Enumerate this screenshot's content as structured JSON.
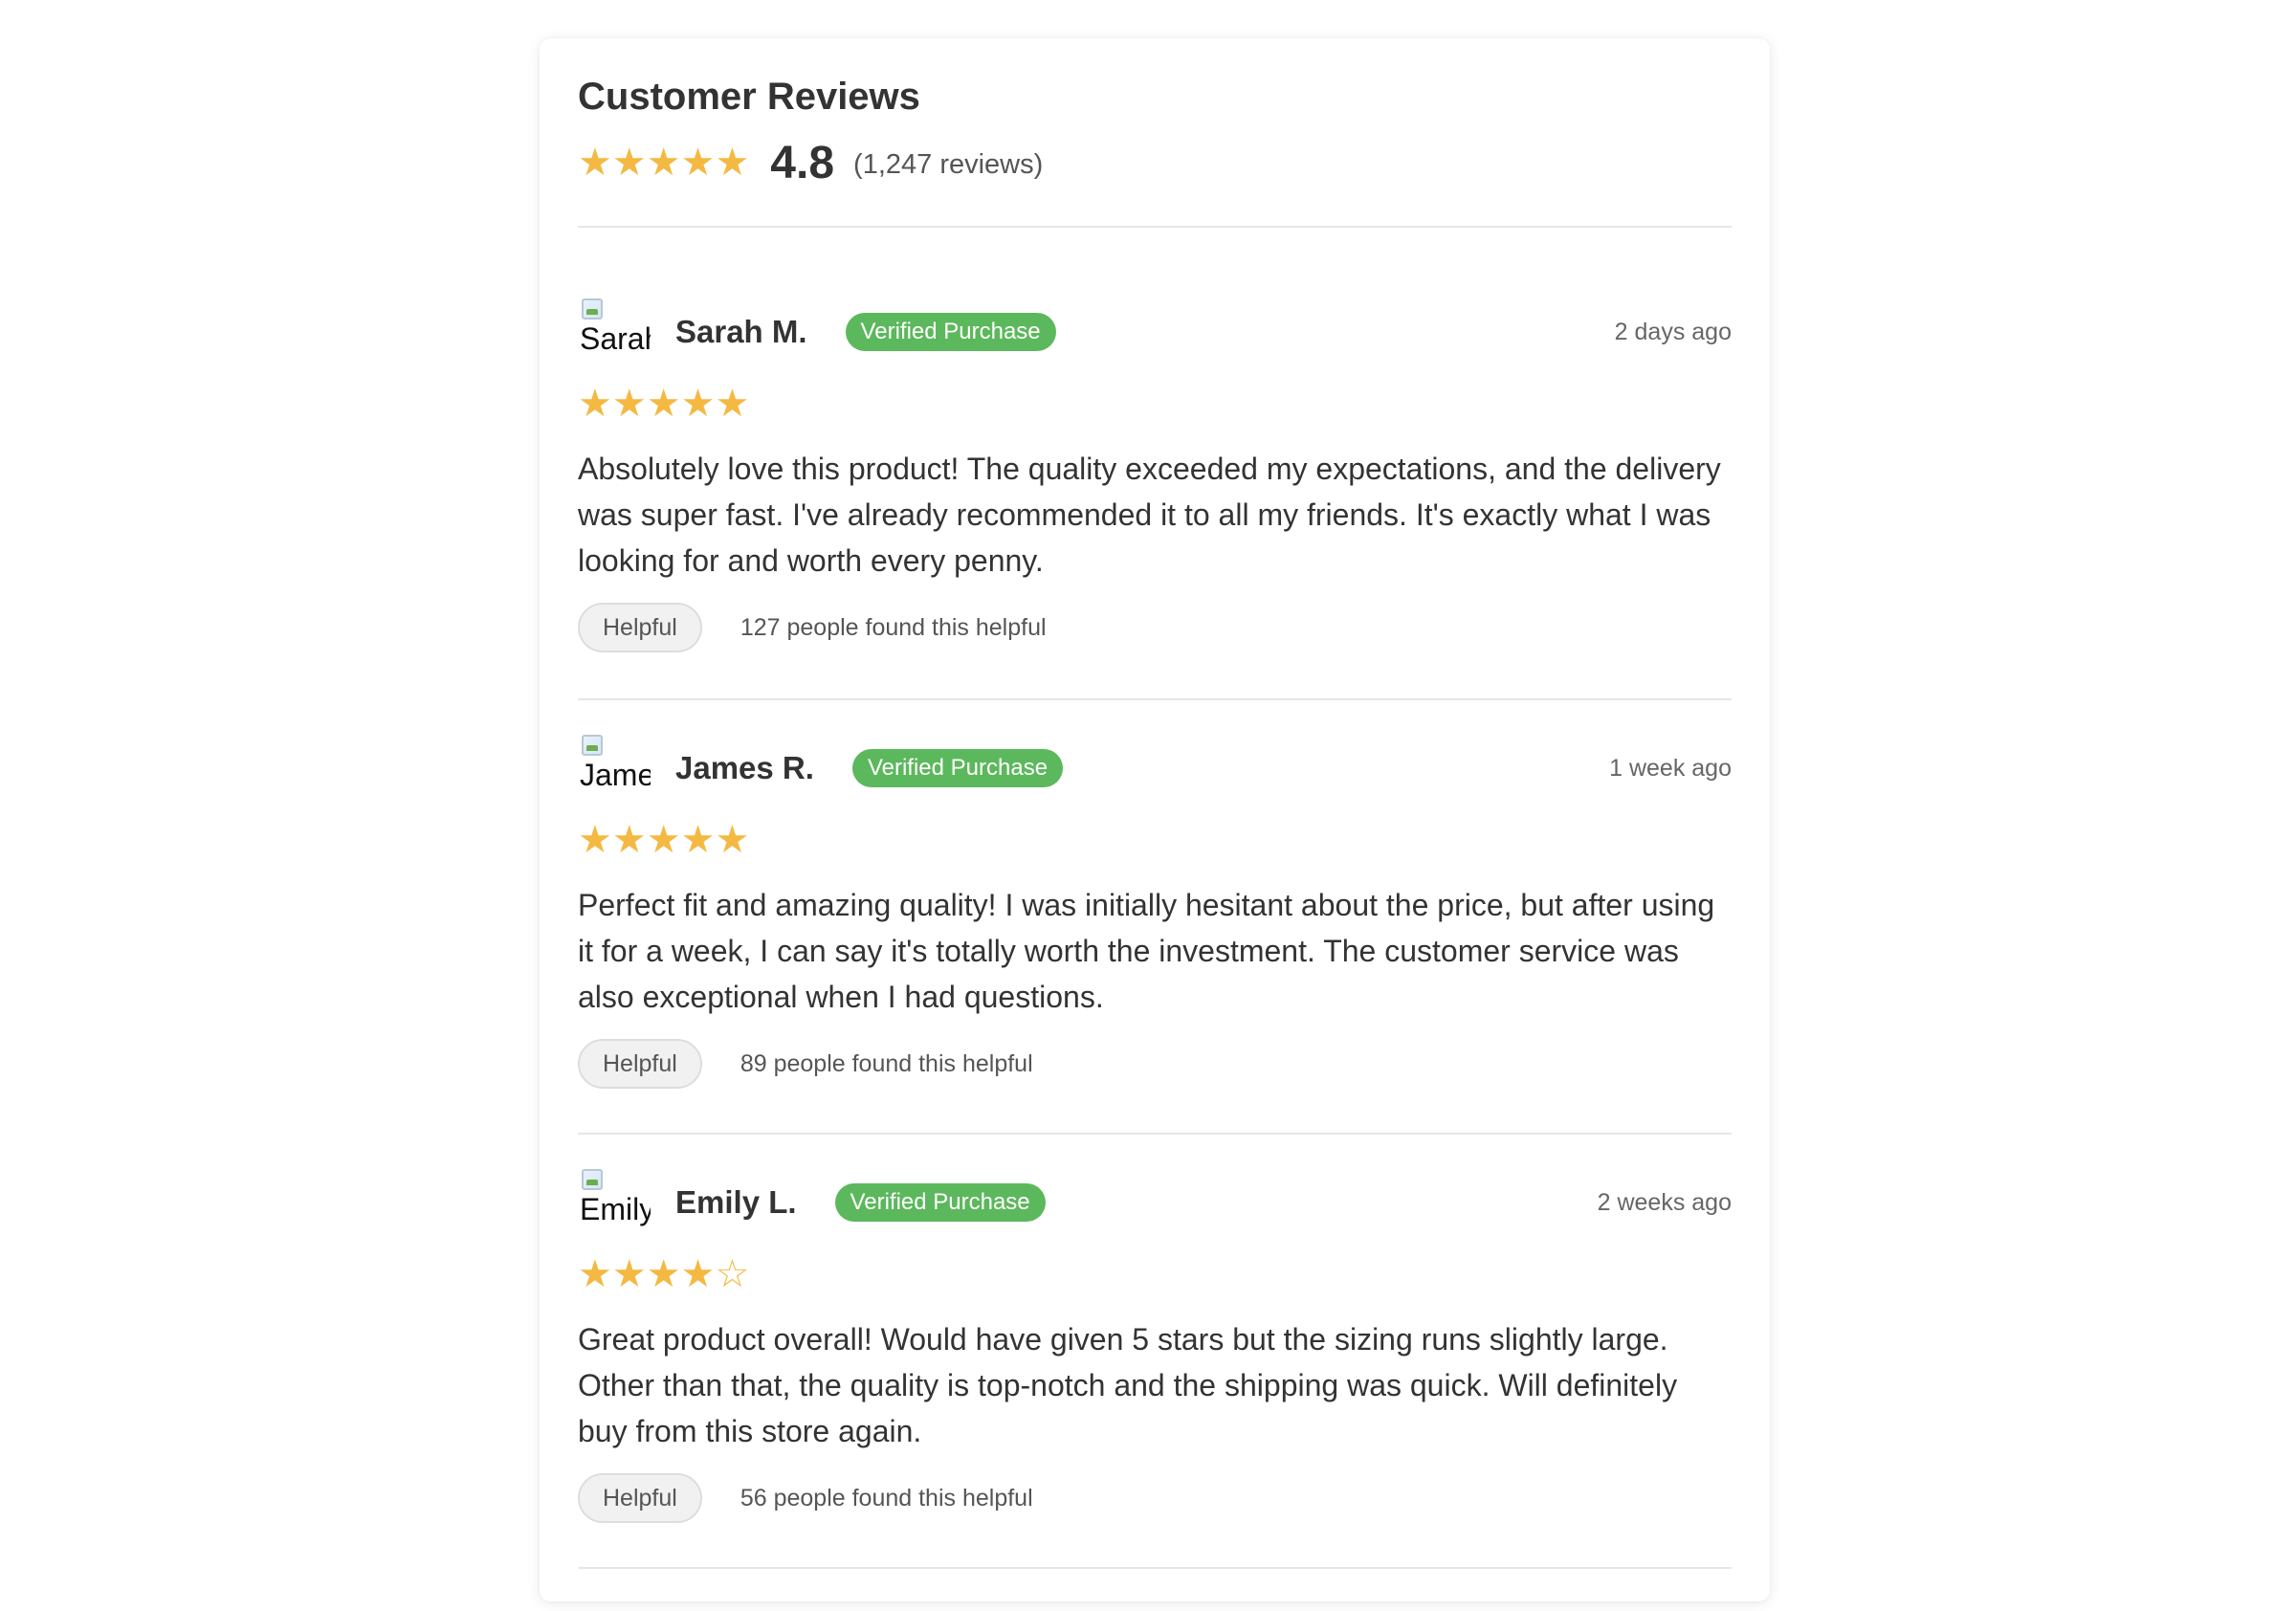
{
  "header": {
    "title": "Customer Reviews",
    "stars": "★★★★★",
    "average": "4.8",
    "count": "(1,247 reviews)"
  },
  "colors": {
    "star": "#f4b942",
    "badge": "#5cb85c",
    "divider": "#e6e6e6"
  },
  "reviews": [
    {
      "avatar_alt": "Sarah",
      "name": "Sarah M.",
      "badge": "Verified Purchase",
      "date": "2 days ago",
      "rating": 5,
      "stars": "★★★★★",
      "text": "Absolutely love this product! The quality exceeded my expectations, and the delivery was super fast. I've already recommended it to all my friends. It's exactly what I was looking for and worth every penny.",
      "helpful_label": "Helpful",
      "helpful_count": "127 people found this helpful"
    },
    {
      "avatar_alt": "James",
      "name": "James R.",
      "badge": "Verified Purchase",
      "date": "1 week ago",
      "rating": 5,
      "stars": "★★★★★",
      "text": "Perfect fit and amazing quality! I was initially hesitant about the price, but after using it for a week, I can say it's totally worth the investment. The customer service was also exceptional when I had questions.",
      "helpful_label": "Helpful",
      "helpful_count": "89 people found this helpful"
    },
    {
      "avatar_alt": "Emily",
      "name": "Emily L.",
      "badge": "Verified Purchase",
      "date": "2 weeks ago",
      "rating": 4,
      "stars": "★★★★☆",
      "text": "Great product overall! Would have given 5 stars but the sizing runs slightly large. Other than that, the quality is top-notch and the shipping was quick. Will definitely buy from this store again.",
      "helpful_label": "Helpful",
      "helpful_count": "56 people found this helpful"
    }
  ]
}
